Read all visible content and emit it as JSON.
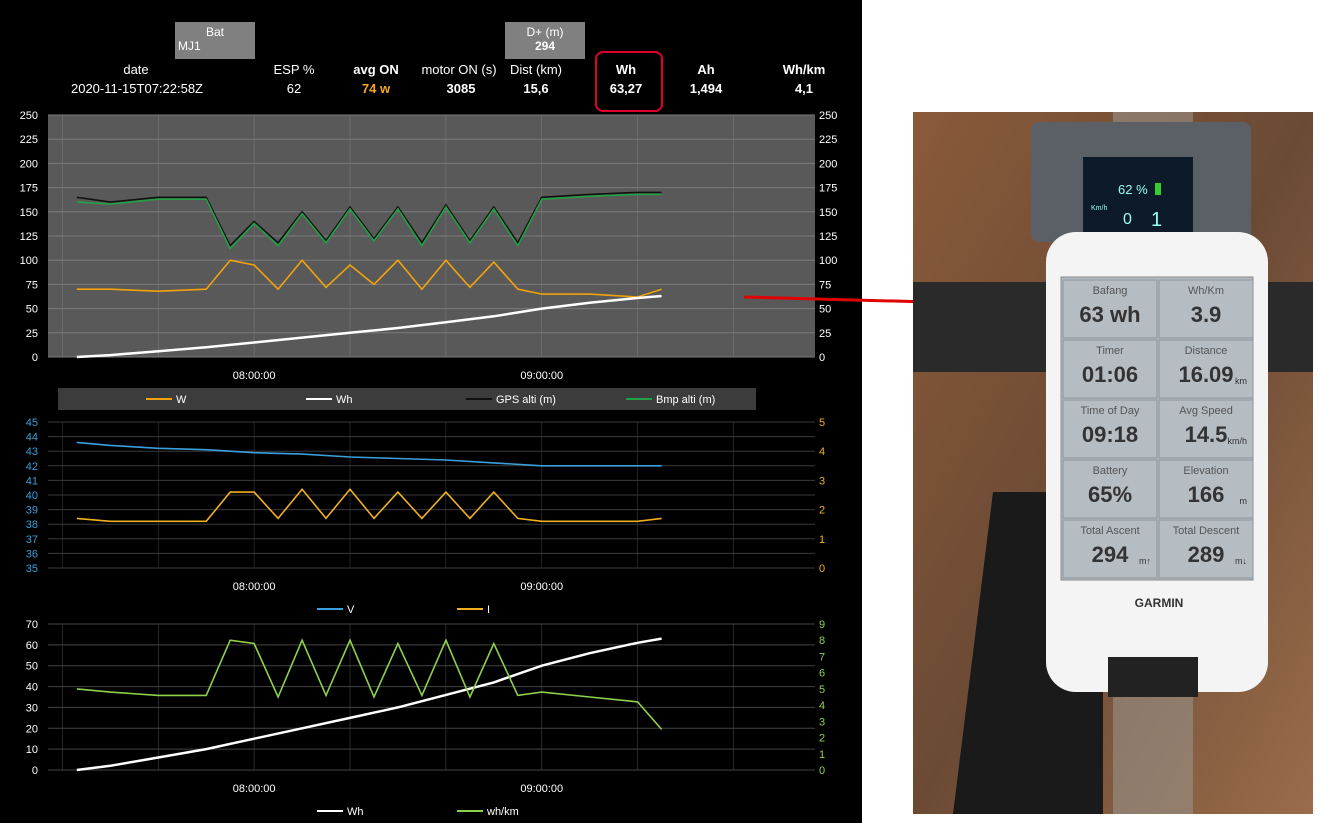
{
  "header": {
    "bat": {
      "label": "Bat",
      "value": "MJ1"
    },
    "dplus": {
      "label": "D+ (m)",
      "value": "294"
    },
    "columns": [
      {
        "label": "date",
        "value": "2020-11-15T07:22:58Z",
        "bold": false
      },
      {
        "label": "ESP %",
        "value": "62",
        "bold": false
      },
      {
        "label": "avg ON",
        "value": "74 w",
        "bold": true
      },
      {
        "label": "motor ON (s)",
        "value": "3085",
        "bold": false
      },
      {
        "label": "Dist (km)",
        "value": "15,6",
        "bold": false
      },
      {
        "label": "Wh",
        "value": "63,27",
        "bold": true
      },
      {
        "label": "Ah",
        "value": "1,494",
        "bold": true
      },
      {
        "label": "Wh/km",
        "value": "4,1",
        "bold": true
      }
    ],
    "highlight_color": "#e0002a",
    "avg_on_color": "#f5a623"
  },
  "chart_data": [
    {
      "type": "line",
      "y_left": {
        "range": [
          0,
          250
        ],
        "ticks": [
          "0",
          "25",
          "50",
          "75",
          "100",
          "125",
          "150",
          "175",
          "200",
          "225",
          "250"
        ]
      },
      "y_right": {
        "range": [
          0,
          250
        ],
        "ticks": [
          "0",
          "25",
          "50",
          "75",
          "100",
          "125",
          "150",
          "175",
          "200",
          "225",
          "250"
        ]
      },
      "x_ticks": [
        "08:00:00",
        "09:00:00"
      ],
      "legend": [
        "W",
        "Wh",
        "GPS alti (m)",
        "Bmp alti (m)"
      ],
      "series": [
        {
          "name": "W",
          "color": "#f0a30a",
          "x": [
            "07:23",
            "07:30",
            "07:40",
            "07:50",
            "07:55",
            "08:00",
            "08:05",
            "08:10",
            "08:15",
            "08:20",
            "08:25",
            "08:30",
            "08:35",
            "08:40",
            "08:45",
            "08:50",
            "08:55",
            "09:00",
            "09:10",
            "09:20",
            "09:25"
          ],
          "values": [
            70,
            70,
            68,
            70,
            100,
            95,
            70,
            100,
            72,
            95,
            75,
            100,
            70,
            100,
            72,
            98,
            70,
            65,
            65,
            62,
            70
          ]
        },
        {
          "name": "Wh",
          "color": "#ffffff",
          "x": [
            "07:23",
            "07:30",
            "07:40",
            "07:50",
            "08:00",
            "08:10",
            "08:20",
            "08:30",
            "08:40",
            "08:50",
            "09:00",
            "09:10",
            "09:20",
            "09:25"
          ],
          "values": [
            0,
            2,
            6,
            10,
            15,
            20,
            25,
            30,
            36,
            42,
            50,
            56,
            61,
            63
          ]
        },
        {
          "name": "GPS alti (m)",
          "color": "#111111",
          "x": [
            "07:23",
            "07:30",
            "07:40",
            "07:50",
            "07:55",
            "08:00",
            "08:05",
            "08:10",
            "08:15",
            "08:20",
            "08:25",
            "08:30",
            "08:35",
            "08:40",
            "08:45",
            "08:50",
            "08:55",
            "09:00",
            "09:10",
            "09:20",
            "09:25"
          ],
          "values": [
            165,
            160,
            165,
            165,
            115,
            140,
            118,
            150,
            120,
            155,
            122,
            155,
            118,
            157,
            120,
            155,
            118,
            165,
            168,
            170,
            170
          ]
        },
        {
          "name": "Bmp alti (m)",
          "color": "#22a045",
          "x": [
            "07:23",
            "07:30",
            "07:40",
            "07:50",
            "07:55",
            "08:00",
            "08:05",
            "08:10",
            "08:15",
            "08:20",
            "08:25",
            "08:30",
            "08:35",
            "08:40",
            "08:45",
            "08:50",
            "08:55",
            "09:00",
            "09:10",
            "09:20",
            "09:25"
          ],
          "values": [
            160,
            158,
            163,
            163,
            112,
            138,
            115,
            148,
            118,
            153,
            120,
            153,
            115,
            155,
            118,
            153,
            115,
            163,
            166,
            168,
            168
          ]
        }
      ]
    },
    {
      "type": "line",
      "y_left": {
        "range": [
          35,
          45
        ],
        "ticks": [
          "35",
          "36",
          "37",
          "38",
          "39",
          "40",
          "41",
          "42",
          "43",
          "44",
          "45"
        ]
      },
      "y_right": {
        "range": [
          0,
          5
        ],
        "ticks": [
          "0",
          "1",
          "2",
          "3",
          "4",
          "5"
        ]
      },
      "x_ticks": [
        "08:00:00",
        "09:00:00"
      ],
      "legend": [
        "V",
        "I"
      ],
      "series": [
        {
          "name": "V",
          "color": "#3aa0dc",
          "axis": "left",
          "x": [
            "07:23",
            "07:30",
            "07:40",
            "07:50",
            "08:00",
            "08:10",
            "08:20",
            "08:30",
            "08:40",
            "08:50",
            "09:00",
            "09:10",
            "09:20",
            "09:25"
          ],
          "values": [
            43.6,
            43.4,
            43.2,
            43.1,
            42.9,
            42.8,
            42.6,
            42.5,
            42.4,
            42.2,
            42.0,
            42.0,
            42.0,
            42.0
          ]
        },
        {
          "name": "I",
          "color": "#f0b020",
          "axis": "right",
          "x": [
            "07:23",
            "07:30",
            "07:40",
            "07:50",
            "07:55",
            "08:00",
            "08:05",
            "08:10",
            "08:15",
            "08:20",
            "08:25",
            "08:30",
            "08:35",
            "08:40",
            "08:45",
            "08:50",
            "08:55",
            "09:00",
            "09:10",
            "09:20",
            "09:25"
          ],
          "values": [
            1.7,
            1.6,
            1.6,
            1.6,
            2.6,
            2.6,
            1.7,
            2.7,
            1.7,
            2.7,
            1.7,
            2.6,
            1.7,
            2.6,
            1.7,
            2.6,
            1.7,
            1.6,
            1.6,
            1.6,
            1.7
          ]
        }
      ]
    },
    {
      "type": "line",
      "y_left": {
        "range": [
          0,
          70
        ],
        "ticks": [
          "0",
          "10",
          "20",
          "30",
          "40",
          "50",
          "60",
          "70"
        ]
      },
      "y_right": {
        "range": [
          0,
          9
        ],
        "ticks": [
          "0",
          "1",
          "2",
          "3",
          "4",
          "5",
          "6",
          "7",
          "8",
          "9"
        ]
      },
      "x_ticks": [
        "08:00:00",
        "09:00:00"
      ],
      "legend": [
        "Wh",
        "wh/km"
      ],
      "series": [
        {
          "name": "Wh",
          "color": "#ffffff",
          "axis": "left",
          "x": [
            "07:23",
            "07:30",
            "07:40",
            "07:50",
            "08:00",
            "08:10",
            "08:20",
            "08:30",
            "08:40",
            "08:50",
            "09:00",
            "09:10",
            "09:20",
            "09:25"
          ],
          "values": [
            0,
            2,
            6,
            10,
            15,
            20,
            25,
            30,
            36,
            42,
            50,
            56,
            61,
            63
          ]
        },
        {
          "name": "wh/km",
          "color": "#8ed14a",
          "axis": "right",
          "x": [
            "07:23",
            "07:30",
            "07:40",
            "07:50",
            "07:55",
            "08:00",
            "08:05",
            "08:10",
            "08:15",
            "08:20",
            "08:25",
            "08:30",
            "08:35",
            "08:40",
            "08:45",
            "08:50",
            "08:55",
            "09:00",
            "09:10",
            "09:20",
            "09:25"
          ],
          "values": [
            5,
            4.8,
            4.6,
            4.6,
            8,
            7.8,
            4.5,
            8,
            4.6,
            8,
            4.5,
            7.8,
            4.6,
            8,
            4.5,
            7.8,
            4.6,
            4.8,
            4.5,
            4.2,
            2.5
          ]
        }
      ]
    }
  ],
  "garmin": {
    "fields": [
      {
        "label": "Bafang",
        "value": "63 wh"
      },
      {
        "label": "Wh/Km",
        "value": "3.9"
      },
      {
        "label": "Timer",
        "value": "01:06"
      },
      {
        "label": "Distance",
        "value": "16.09",
        "unit": "km"
      },
      {
        "label": "Time of Day",
        "value": "09:18"
      },
      {
        "label": "Avg Speed",
        "value": "14.5",
        "unit": "km/h"
      },
      {
        "label": "Battery",
        "value": "65%"
      },
      {
        "label": "Elevation",
        "value": "166",
        "unit": "m"
      },
      {
        "label": "Total Ascent",
        "value": "294",
        "unit": "m↑"
      },
      {
        "label": "Total Descent",
        "value": "289",
        "unit": "m↓"
      }
    ],
    "brand": "GARMIN",
    "display": {
      "battery": "62 %",
      "speed_unit": "Km/h",
      "speed": "0",
      "assist": "1"
    }
  }
}
